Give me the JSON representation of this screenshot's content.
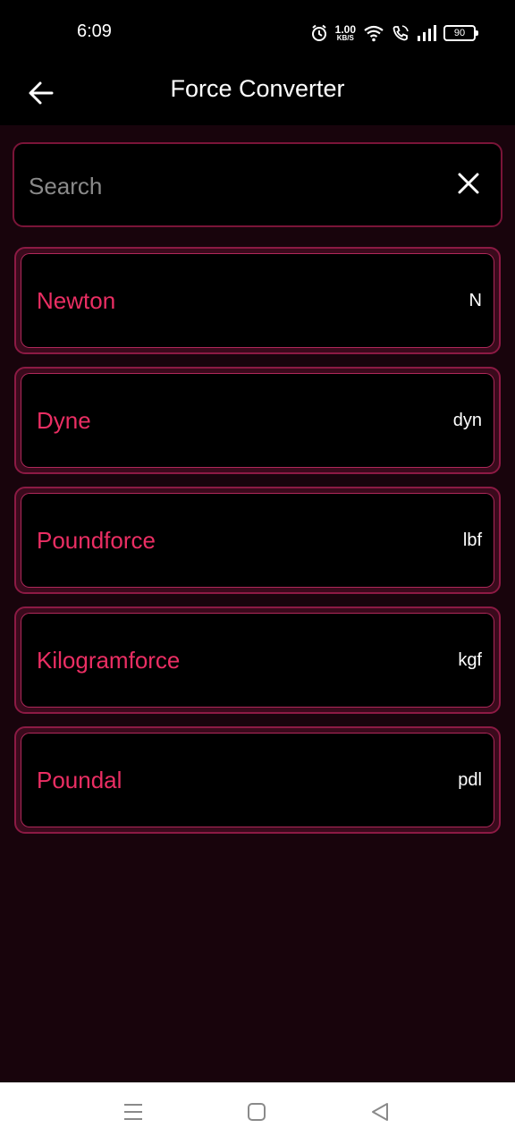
{
  "status_bar": {
    "time": "6:09",
    "net_speed_value": "1.00",
    "net_speed_unit": "KB/S",
    "battery": "90",
    "icons": [
      "alarm-icon",
      "wifi-icon",
      "call-icon",
      "signal-icon",
      "battery-icon"
    ]
  },
  "app_bar": {
    "title": "Force Converter",
    "back_icon": "arrow-left-icon"
  },
  "search": {
    "placeholder": "Search",
    "value": "",
    "clear_icon": "close-icon"
  },
  "units": [
    {
      "name": "Newton",
      "symbol": "N"
    },
    {
      "name": "Dyne",
      "symbol": "dyn"
    },
    {
      "name": "Poundforce",
      "symbol": "lbf"
    },
    {
      "name": "Kilogramforce",
      "symbol": "kgf"
    },
    {
      "name": "Poundal",
      "symbol": "pdl"
    }
  ],
  "colors": {
    "accent": "#ea2e63",
    "card_border": "#8c1a44",
    "background": "#18040c"
  },
  "nav_bar": {
    "icons": [
      "menu-icon",
      "home-square-icon",
      "back-triangle-icon"
    ]
  }
}
